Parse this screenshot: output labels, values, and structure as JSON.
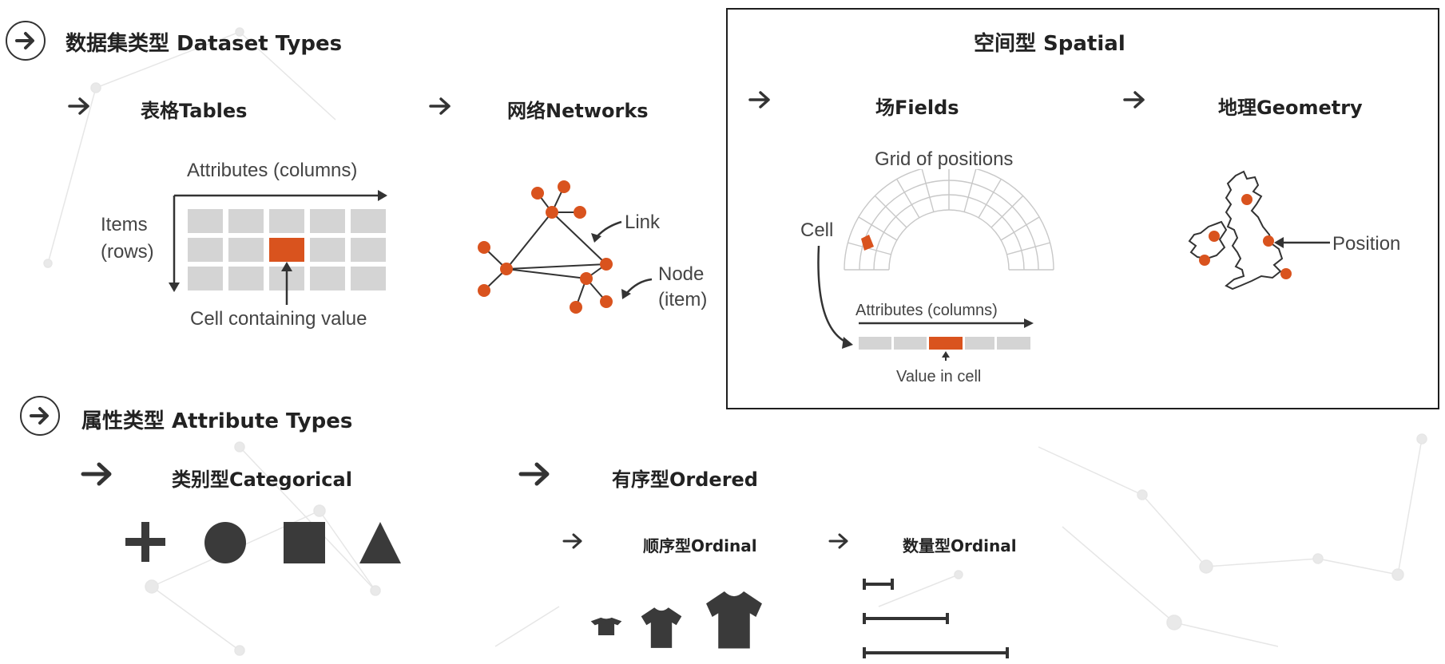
{
  "dataset": {
    "title": "数据集类型 Dataset Types",
    "tables": {
      "title": "表格Tables",
      "attributes_label": "Attributes (columns)",
      "items_label_1": "Items",
      "items_label_2": "(rows)",
      "cell_label": "Cell containing value"
    },
    "networks": {
      "title": "网络Networks",
      "link_label": "Link",
      "node_label_1": "Node",
      "node_label_2": "(item)"
    },
    "spatial": {
      "title": "空间型 Spatial",
      "fields": {
        "title": "场Fields",
        "grid_label": "Grid of positions",
        "cell_label": "Cell",
        "attributes_label": "Attributes (columns)",
        "value_label": "Value in cell"
      },
      "geometry": {
        "title": "地理Geometry",
        "position_label": "Position"
      }
    }
  },
  "attributes": {
    "title": "属性类型 Attribute Types",
    "categorical": {
      "title": "类别型Categorical",
      "icons": [
        "plus-icon",
        "circle-icon",
        "square-icon",
        "triangle-icon"
      ]
    },
    "ordered": {
      "title": "有序型Ordered",
      "ordinal": {
        "title": "顺序型Ordinal"
      },
      "quantitative": {
        "title": "数量型Ordinal"
      }
    }
  },
  "colors": {
    "accent": "#d9531e",
    "cell_gray": "#d4d4d4",
    "dark": "#333333"
  }
}
